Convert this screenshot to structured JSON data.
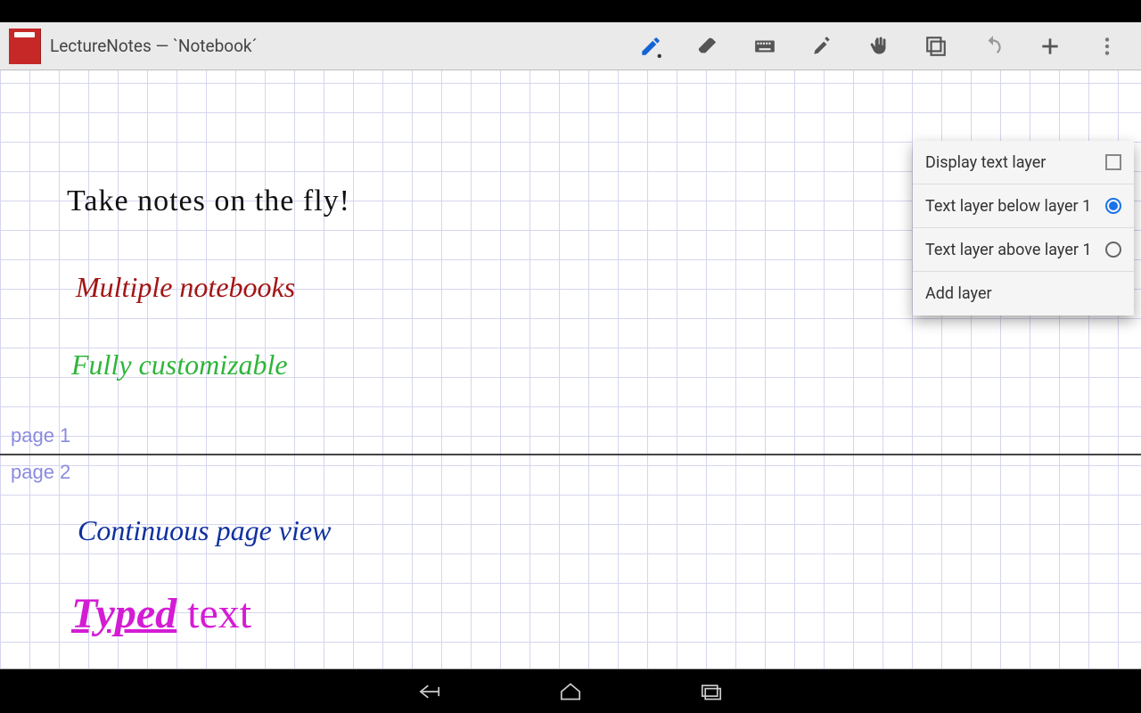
{
  "header": {
    "title": "LectureNotes — `Notebook´"
  },
  "toolbar_icons": {
    "pencil": "pencil-icon",
    "eraser": "eraser-icon",
    "keyboard": "keyboard-icon",
    "marker": "marker-icon",
    "hand": "hand-icon",
    "layers": "layers-icon",
    "undo": "undo-icon",
    "add": "add-icon",
    "overflow": "overflow-icon"
  },
  "handwriting": {
    "line1": "Take notes on the fly!",
    "line2": "Multiple notebooks",
    "line3": "Fully customizable",
    "line4": "Continuous page view"
  },
  "pages": {
    "label1": "page 1",
    "label2": "page 2"
  },
  "typed": {
    "bold": "Typed",
    "rest": " text"
  },
  "menu": {
    "display_text_layer": "Display text layer",
    "below": "Text layer below layer 1",
    "above": "Text layer above layer 1",
    "add_layer": "Add layer",
    "checked": false,
    "selected": "below"
  }
}
